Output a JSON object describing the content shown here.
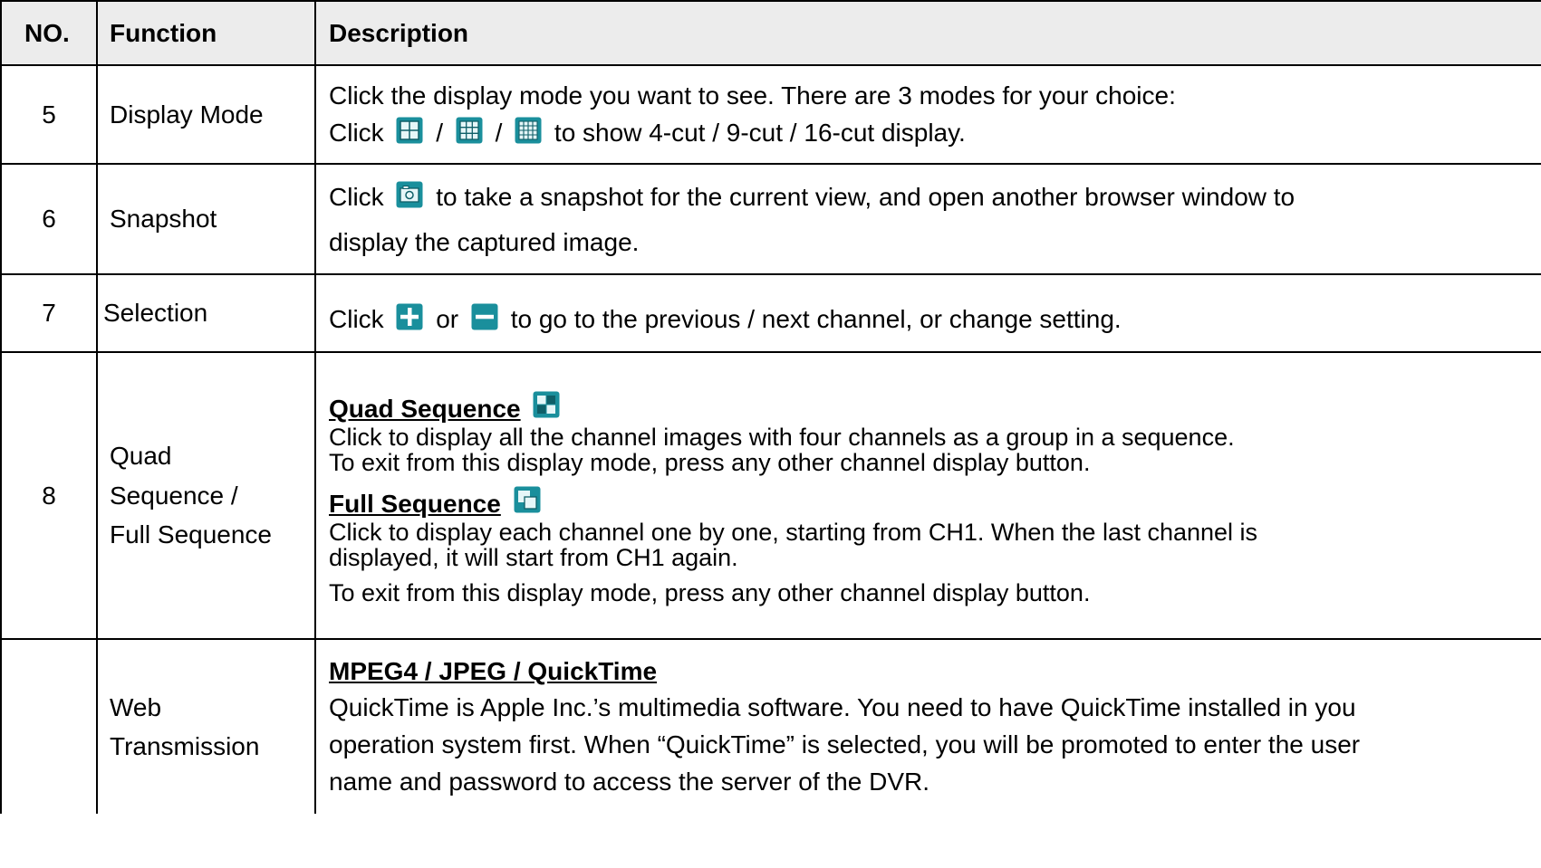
{
  "headers": {
    "no": "NO.",
    "function": "Function",
    "description": "Description"
  },
  "rows": [
    {
      "no": "5",
      "function": "Display Mode",
      "line1": "Click the display mode you want to see. There are 3 modes for your choice:",
      "click": "Click",
      "sep1": "/",
      "sep2": "/",
      "after": "to show 4-cut / 9-cut / 16-cut display.",
      "icons": [
        "4-cut-grid-icon",
        "9-cut-grid-icon",
        "16-cut-grid-icon"
      ]
    },
    {
      "no": "6",
      "function": "Snapshot",
      "click": "Click",
      "after": "to take a snapshot for the current view, and open another browser window to",
      "line2": "display the captured image.",
      "icons": [
        "camera-icon"
      ]
    },
    {
      "no": "7",
      "function": "Selection",
      "click": "Click",
      "or": "or",
      "after": "to go to the previous / next channel, or change setting.",
      "icons": [
        "plus-icon",
        "minus-icon"
      ]
    },
    {
      "no": "8",
      "function_lines": [
        "Quad",
        "Sequence /",
        "Full Sequence"
      ],
      "quad_heading": "Quad Sequence",
      "quad_line1": "Click to display all the channel images with four channels as a group in a sequence.",
      "quad_line2": "To exit from this display mode, press any other channel display button.",
      "full_heading": "Full Sequence",
      "full_line1": "Click to display each channel one by one, starting from CH1. When the last channel is",
      "full_line2": "displayed, it will start from CH1 again.",
      "full_line3": "To exit from this display mode, press any other channel display button.",
      "icons": [
        "quad-sequence-icon",
        "full-sequence-icon"
      ]
    },
    {
      "no": "",
      "function_lines": [
        "Web",
        "Transmission"
      ],
      "heading": "MPEG4 / JPEG / QuickTime",
      "line1": "QuickTime is Apple Inc.’s multimedia software. You need to have QuickTime installed in you",
      "line2": "operation system first. When “QuickTime” is selected, you will be promoted to enter the user",
      "line3": "name and password to access the server of the DVR."
    }
  ],
  "colors": {
    "icon_teal": "#1a8f9c",
    "icon_light": "#e6f6f8",
    "header_bg": "#ececec",
    "border": "#000000"
  }
}
